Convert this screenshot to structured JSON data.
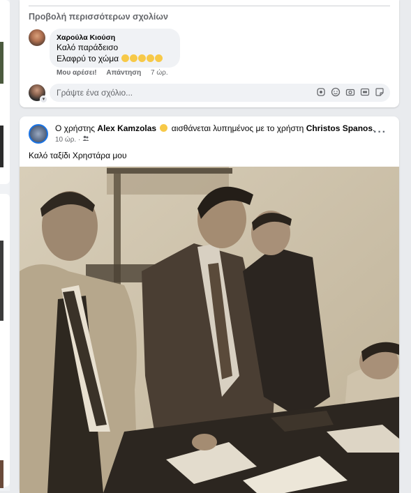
{
  "comments": {
    "view_more": "Προβολή περισσότερων σχολίων",
    "items": [
      {
        "author": "Χαρούλα Κιούση",
        "line1": "Καλό παράδεισο",
        "line2": "Ελαφρύ το χώμα",
        "like": "Μου αρέσει!",
        "reply": "Απάντηση",
        "time": "7 ώρ."
      }
    ],
    "input_placeholder": "Γράψτε ένα σχόλιο..."
  },
  "post": {
    "header_prefix": "Ο χρήστης ",
    "author": "Alex Kamzolas",
    "feeling_text": " αισθάνεται λυπημένος με το χρήστη ",
    "tagged": "Christos Spanos",
    "header_suffix": ".",
    "time": "10 ώρ.",
    "audience_icon": "friends-icon",
    "text": "Καλό ταξίδι Χρηστάρα μου"
  },
  "colors": {
    "accent": "#1b74e4",
    "muted": "#65676b",
    "bubble": "#f0f2f5",
    "photo_sepia": "#cbbfa8"
  }
}
